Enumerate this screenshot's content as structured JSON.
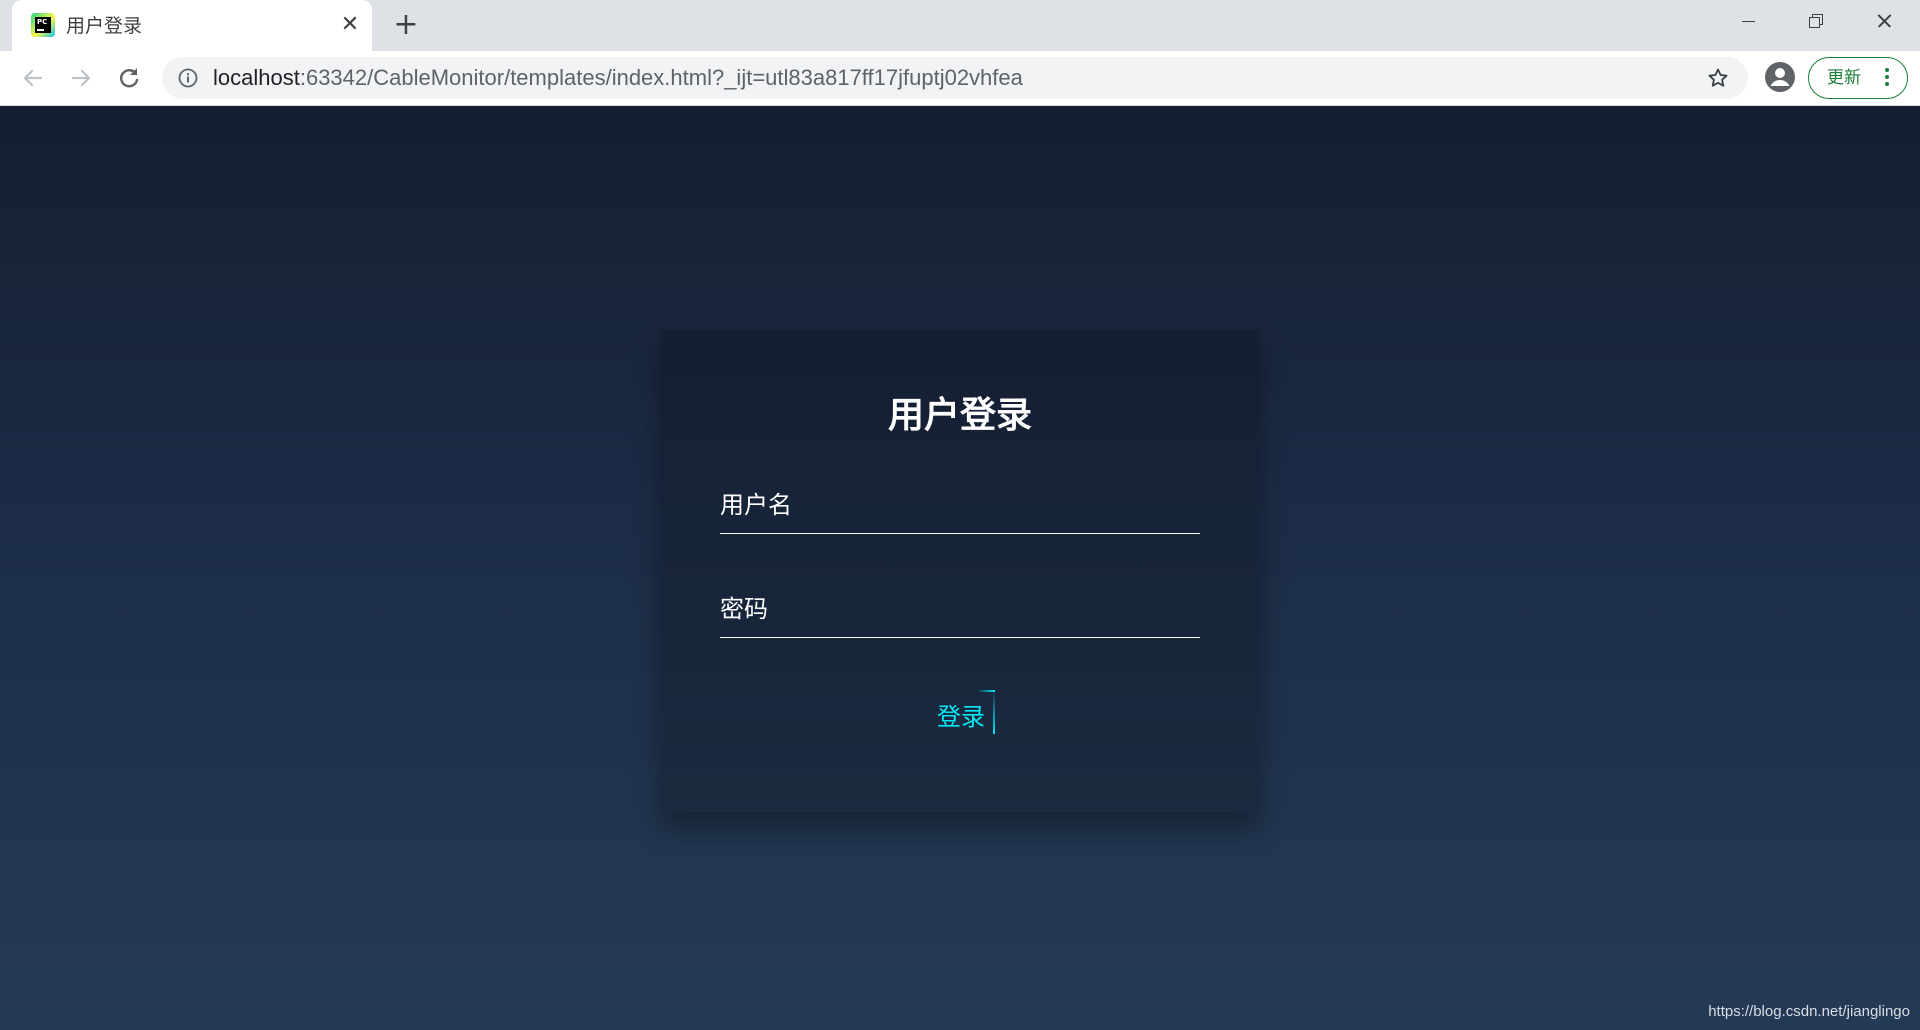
{
  "browser": {
    "tab": {
      "title": "用户登录",
      "close_glyph": "✕",
      "favicon": "pycharm-icon"
    },
    "new_tab_glyph": "+",
    "address": {
      "host": "localhost",
      "rest": ":63342/CableMonitor/templates/index.html?_ijt=utl83a817ff17jfuptj02vhfea"
    },
    "update_button": {
      "label": "更新"
    },
    "accent_color": "#188038"
  },
  "login": {
    "title": "用户登录",
    "username_label": "用户名",
    "password_label": "密码",
    "submit_label": "登录",
    "accent_color": "#03e9f4"
  },
  "watermark": "https://blog.csdn.net/jianglingo"
}
